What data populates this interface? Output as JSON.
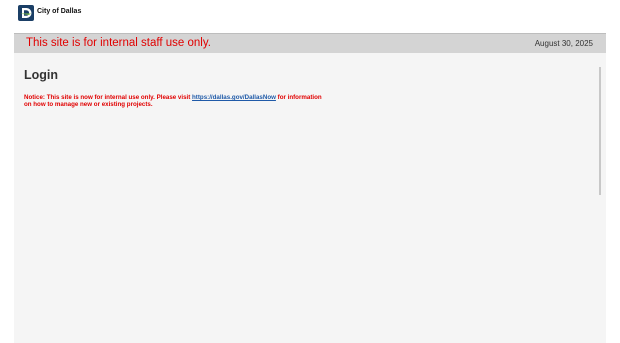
{
  "header": {
    "logo_icon": "city-of-dallas-d-logo-icon",
    "org_name": "City of Dallas"
  },
  "banner": {
    "message": "This site is for internal staff use only.",
    "date": "August 30, 2025"
  },
  "login": {
    "title": "Login",
    "notice_prefix": "Notice: This site is now for internal use only. Please visit ",
    "notice_link": "https://dallas.gov/DallasNow",
    "notice_suffix": " for information on how to manage new or existing projects."
  },
  "colors": {
    "banner_bg": "#d4d4d4",
    "alert_red": "#e10000",
    "link_blue": "#1f5aa8",
    "logo_navy": "#1b3f66",
    "logo_green": "#7dbd4a"
  }
}
